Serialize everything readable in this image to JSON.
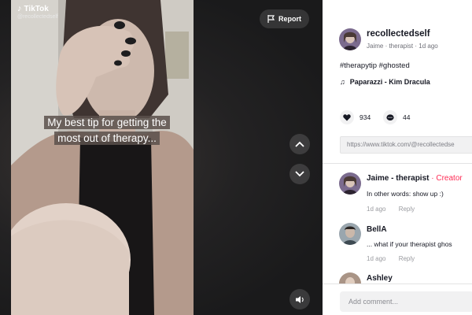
{
  "video": {
    "logo_text": "TikTok",
    "handle": "@recollectedself",
    "caption_lines": [
      "My best tip for getting the",
      "most out of therapy..."
    ],
    "report_label": "Report"
  },
  "author": {
    "username": "recollectedself",
    "meta": "Jaime · therapist · 1d ago"
  },
  "description": {
    "hashtags": "#therapytip #ghosted",
    "music": "Paparazzi - Kim Dracula"
  },
  "stats": {
    "likes": "934",
    "comments": "44"
  },
  "share_link": "https://www.tiktok.com/@recollectedse",
  "comments": [
    {
      "author": "Jaime - therapist",
      "badge": "· Creator",
      "text": "In other words: show up :)",
      "time": "1d ago",
      "reply": "Reply"
    },
    {
      "author": "BellA",
      "badge": "",
      "text": "... what if your therapist ghos",
      "time": "1d ago",
      "reply": "Reply"
    },
    {
      "author": "Ashley",
      "badge": "",
      "text": "",
      "time": "",
      "reply": ""
    }
  ],
  "comment_input": {
    "placeholder": "Add comment..."
  },
  "colors": {
    "creator_accent": "#fe2c55",
    "panel_bg": "#ffffff",
    "stage_bg": "#1e1e1f"
  },
  "icons": [
    "tiktok-note-icon",
    "flag-icon",
    "chevron-up-icon",
    "chevron-down-icon",
    "volume-icon",
    "music-note-icon",
    "heart-icon",
    "comment-icon"
  ]
}
